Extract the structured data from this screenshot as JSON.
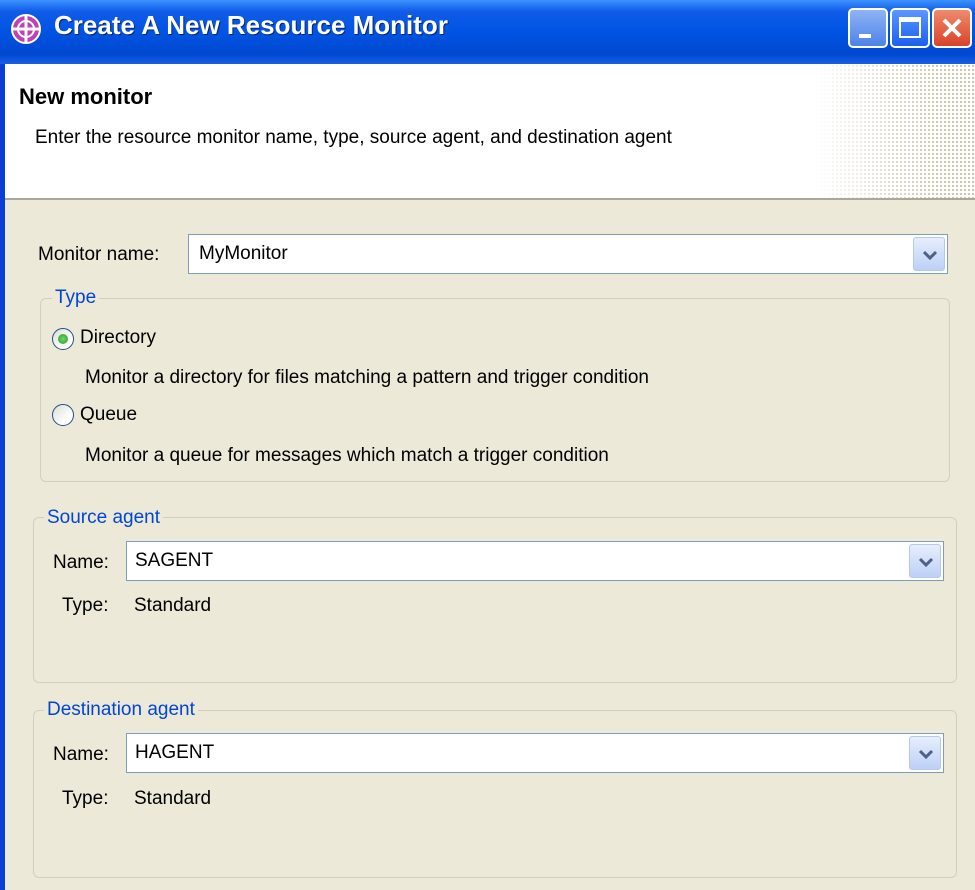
{
  "window": {
    "title": "Create A New Resource Monitor",
    "controls": [
      "minimize",
      "maximize",
      "close"
    ],
    "icon": "plus-circle-icon"
  },
  "header": {
    "title": "New monitor",
    "description": "Enter the resource monitor name, type, source agent, and destination agent"
  },
  "monitor_name": {
    "label": "Monitor name:",
    "value": "MyMonitor"
  },
  "type_group": {
    "legend": "Type",
    "options": [
      {
        "label": "Directory",
        "description": "Monitor a directory for files matching a pattern and trigger condition",
        "selected": true
      },
      {
        "label": "Queue",
        "description": "Monitor a queue for messages which match a trigger condition",
        "selected": false
      }
    ]
  },
  "source_agent": {
    "legend": "Source agent",
    "name_label": "Name:",
    "name_value": "SAGENT",
    "type_label": "Type:",
    "type_value": "Standard"
  },
  "destination_agent": {
    "legend": "Destination agent",
    "name_label": "Name:",
    "name_value": "HAGENT",
    "type_label": "Type:",
    "type_value": "Standard"
  },
  "colors": {
    "titlebar": "#0054e3",
    "dialog_bg": "#ece9d8",
    "legend_text": "#0046d5"
  }
}
